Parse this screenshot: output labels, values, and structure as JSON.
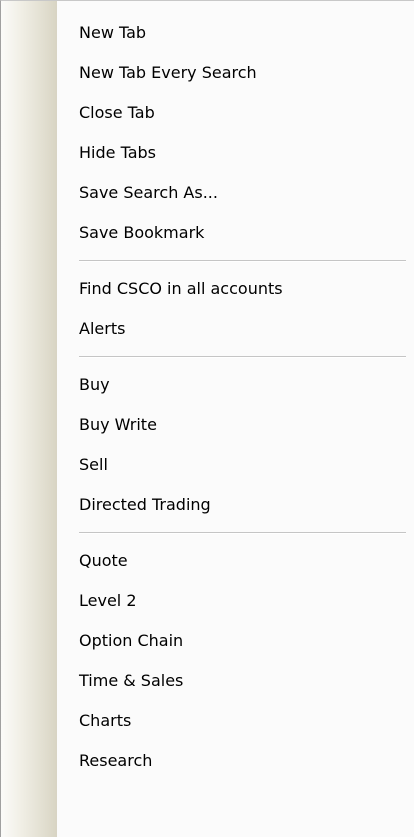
{
  "menu": {
    "items": [
      {
        "label": "New Tab"
      },
      {
        "label": "New Tab Every Search"
      },
      {
        "label": "Close Tab"
      },
      {
        "label": "Hide Tabs"
      },
      {
        "label": "Save Search As..."
      },
      {
        "label": "Save Bookmark"
      },
      {
        "label": "Find CSCO in all accounts"
      },
      {
        "label": "Alerts"
      },
      {
        "label": "Buy"
      },
      {
        "label": "Buy Write"
      },
      {
        "label": "Sell"
      },
      {
        "label": "Directed Trading"
      },
      {
        "label": "Quote"
      },
      {
        "label": "Level 2"
      },
      {
        "label": "Option Chain"
      },
      {
        "label": "Time & Sales"
      },
      {
        "label": "Charts"
      },
      {
        "label": "Research"
      }
    ]
  }
}
